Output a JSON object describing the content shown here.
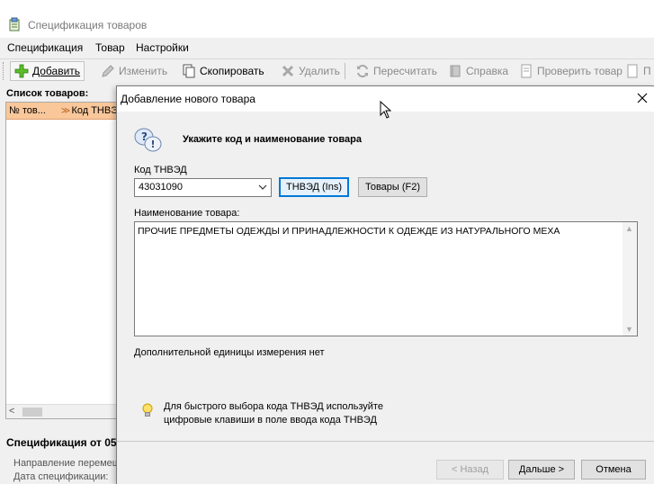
{
  "window": {
    "title": "Спецификация товаров"
  },
  "menu": [
    "Спецификация",
    "Товар",
    "Настройки"
  ],
  "toolbar": {
    "add": "Добавить",
    "edit": "Изменить",
    "copy": "Скопировать",
    "delete": "Удалить",
    "recalc": "Пересчитать",
    "help": "Справка",
    "check": "Проверить товар",
    "more": "П"
  },
  "left_panel": {
    "title": "Список товаров:",
    "columns": [
      "№ тов...",
      "Код ТНВЭ"
    ],
    "spec_title": "Спецификация от 05.",
    "spec_lines": [
      "Направление перемещ",
      "Дата спецификации:"
    ]
  },
  "dialog": {
    "title": "Добавление нового товара",
    "heading": "Укажите код и наименование товара",
    "code_label": "Код ТНВЭД",
    "code_value": "43031090",
    "tnved_button": "ТНВЭД (Ins)",
    "goods_button": "Товары (F2)",
    "name_label": "Наименование товара:",
    "name_value": "ПРОЧИЕ ПРЕДМЕТЫ ОДЕЖДЫ И ПРИНАДЛЕЖНОСТИ К ОДЕЖДЕ ИЗ НАТУРАЛЬНОГО МЕХА",
    "extra_units": "Дополнительной единицы измерения нет",
    "hint": "Для быстрого выбора кода ТНВЭД используйте\nцифровые клавиши в поле ввода кода ТНВЭД",
    "back_button": "< Назад",
    "next_button": "Дальше >",
    "cancel_button": "Отмена"
  },
  "colors": {
    "list_header": "#f9c79a",
    "focus": "#0078d7",
    "add_icon": "#4caf20"
  }
}
